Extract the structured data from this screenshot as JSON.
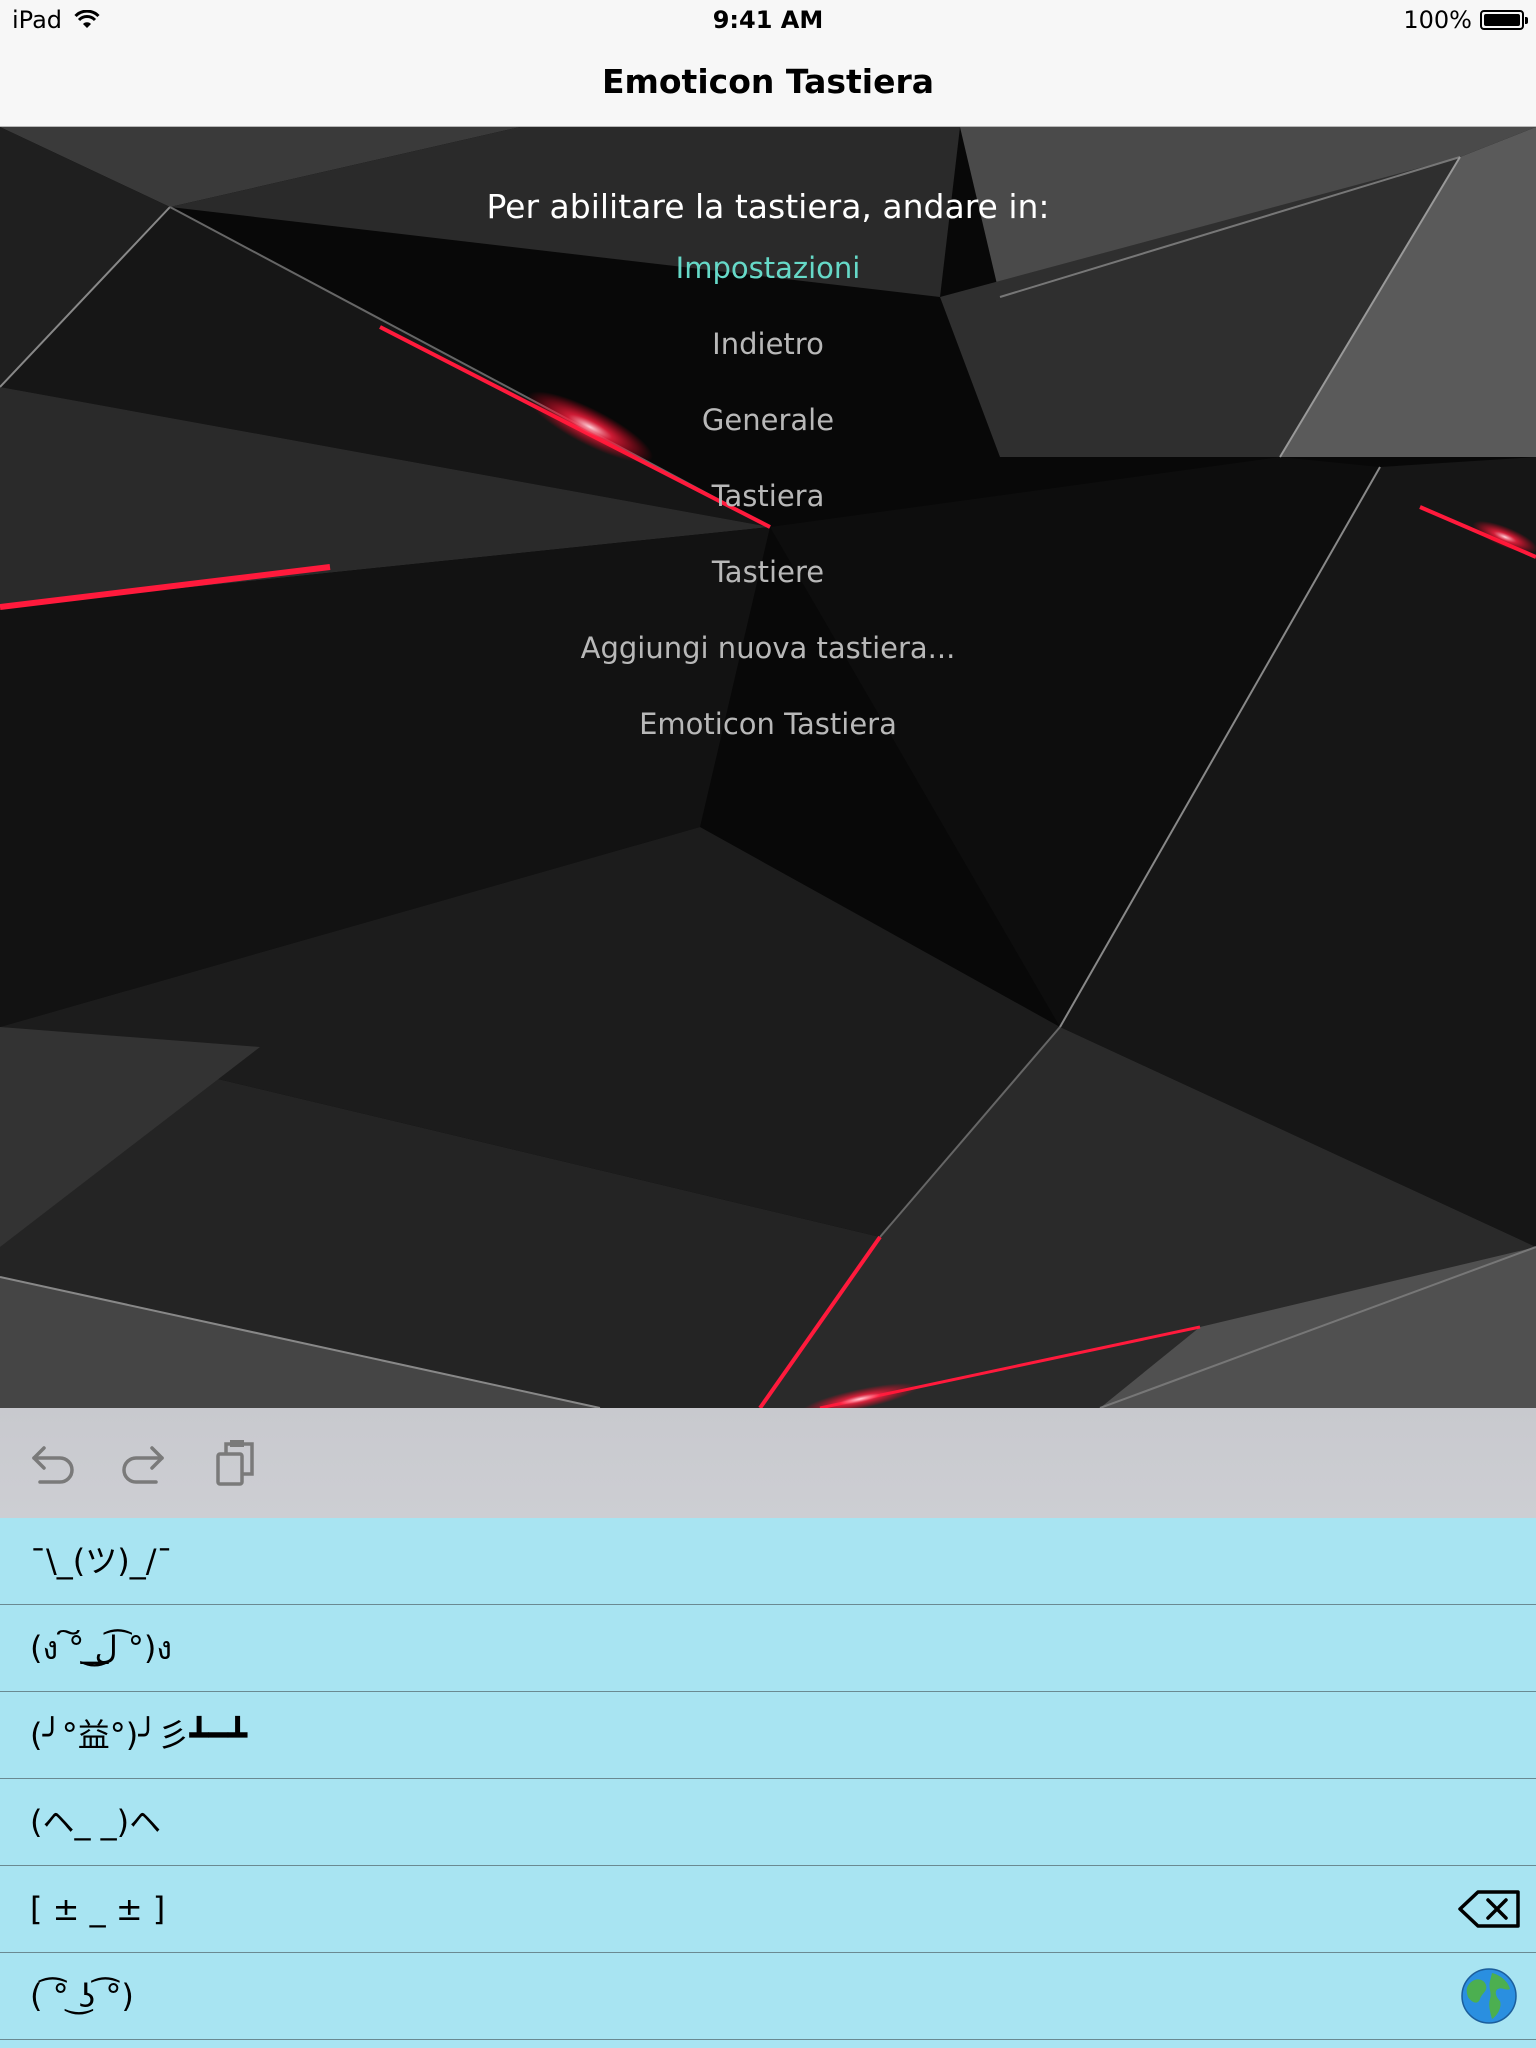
{
  "status_bar": {
    "device": "iPad",
    "time": "9:41 AM",
    "battery": "100%"
  },
  "nav": {
    "title": "Emoticon Tastiera"
  },
  "instructions": {
    "title": "Per abilitare la tastiera, andare in:",
    "steps": [
      "Impostazioni",
      "Indietro",
      "Generale",
      "Tastiera",
      "Tastiere",
      "Aggiungi nuova tastiera...",
      "Emoticon Tastiera"
    ]
  },
  "colors": {
    "highlight": "#66d9c8",
    "step_text": "#b8b8b8",
    "list_background": "#a8e4f2",
    "accent_red": "#ff1a3c"
  },
  "toolbar": {
    "icons": [
      "undo-icon",
      "redo-icon",
      "clipboard-icon"
    ]
  },
  "emoticons": [
    "¯\\_(ツ)_/¯",
    "(ง ͠° ͟ل͜ ͡°)ง",
    "(╯°益°)╯彡┻━┻",
    "(ヘ_ _)ヘ",
    "[ ± _ ± ]",
    "( ͡° ͜ʖ ͡°)"
  ],
  "row_icons": {
    "backspace": "backspace-icon",
    "globe": "globe-icon"
  }
}
